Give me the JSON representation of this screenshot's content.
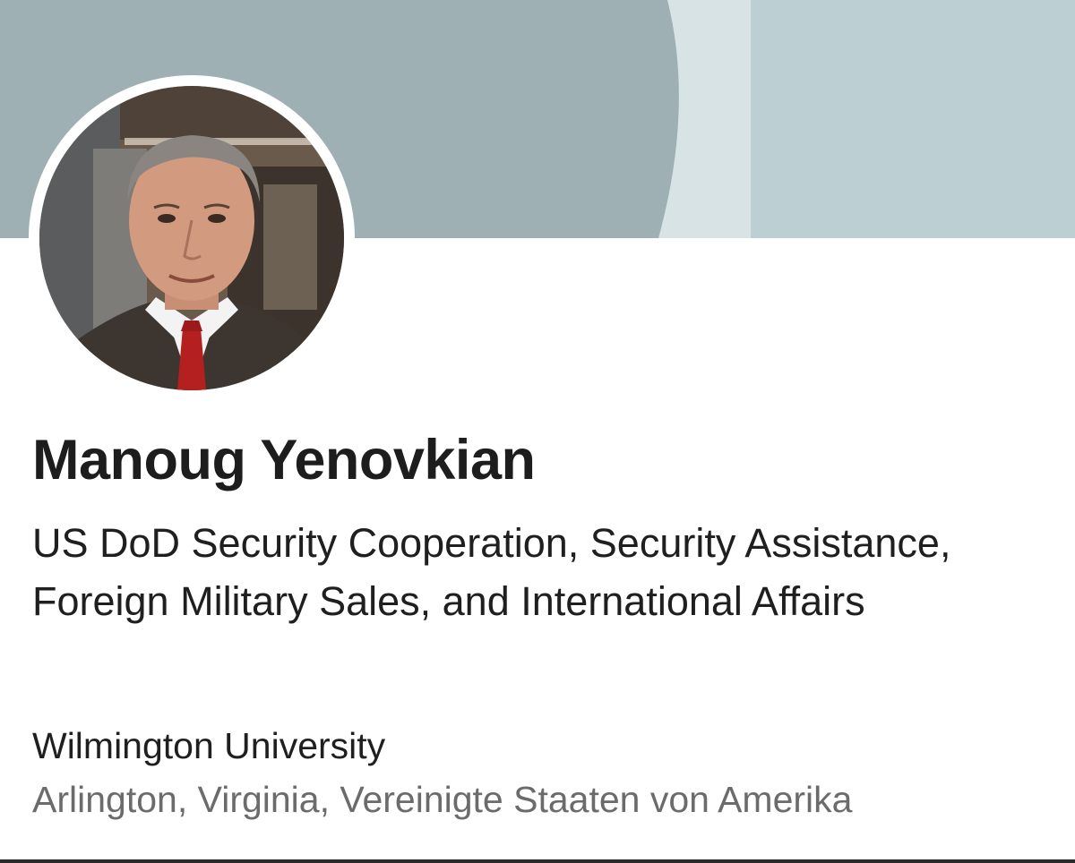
{
  "profile": {
    "name": "Manoug Yenovkian",
    "headline": "US DoD Security Cooperation, Security Assistance, Foreign Military Sales, and International Affairs",
    "education": "Wilmington University",
    "location": "Arlington, Virginia, Vereinigte Staaten von Amerika"
  },
  "colors": {
    "banner_left": "#9eb0b3",
    "banner_middle": "#d8e3e6",
    "banner_right": "#bcd0d4",
    "name_text": "#1d1d1d",
    "secondary_text": "#6b6b6b"
  }
}
